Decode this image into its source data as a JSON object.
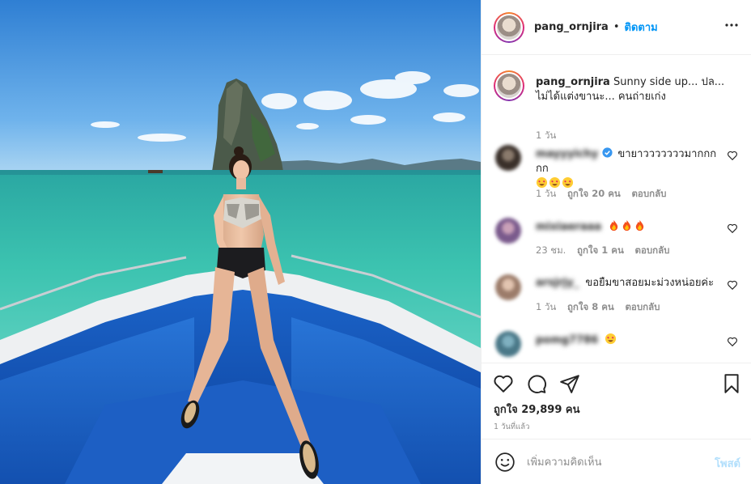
{
  "post": {
    "username": "pang_ornjira",
    "separator": "•",
    "follow_label": "ติดตาม",
    "more_label": "•••"
  },
  "caption": {
    "username": "pang_ornjira",
    "text": "Sunny side up... ปล... ไม่ได้แต่งขานะ... คนถ่ายเก่ง",
    "time": "1 วัน"
  },
  "comments": [
    {
      "username": "mayyyichy",
      "verified": true,
      "text": "ขายาวววววววมากกกกก",
      "emoji": [
        "star-struck-emoji",
        "star-struck-emoji",
        "star-struck-emoji"
      ],
      "time": "1 วัน",
      "likes": "ถูกใจ 20 คน",
      "reply": "ตอบกลับ"
    },
    {
      "username": "mixiaeraaa",
      "verified": false,
      "text": "",
      "emoji": [
        "fire-emoji",
        "fire-emoji",
        "fire-emoji"
      ],
      "time": "23 ชม.",
      "likes": "ถูกใจ 1 คน",
      "reply": "ตอบกลับ"
    },
    {
      "username": "arsjrjy_",
      "verified": false,
      "text": "ขอยืมขาสอยมะม่วงหน่อยค่ะ",
      "emoji": [],
      "time": "1 วัน",
      "likes": "ถูกใจ 8 คน",
      "reply": "ตอบกลับ"
    },
    {
      "username": "pomg7786",
      "verified": false,
      "text": "",
      "emoji": [
        "star-struck-emoji"
      ],
      "time": "",
      "likes": "",
      "reply": ""
    }
  ],
  "actions": {
    "likes_text": "ถูกใจ 29,899 คน",
    "post_time": "1 วันที่แล้ว"
  },
  "add_comment": {
    "placeholder": "เพิ่มความคิดเห็น",
    "post_label": "โพสต์"
  },
  "colors": {
    "link_blue": "#0095f6",
    "post_disabled": "#b2dffc",
    "muted": "#8e8e8e",
    "text": "#262626",
    "border": "#efefef"
  }
}
